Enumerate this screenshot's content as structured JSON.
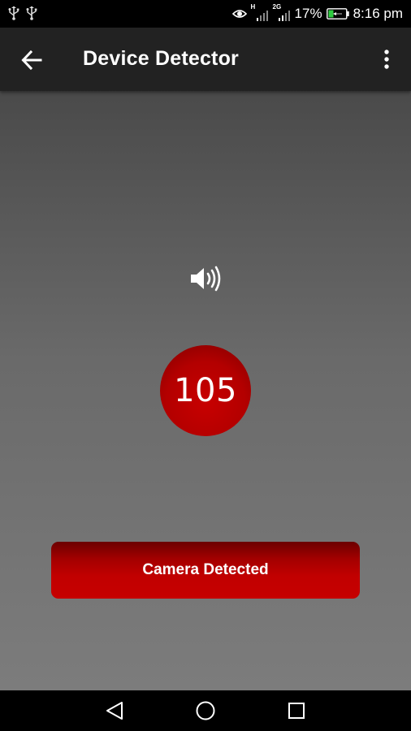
{
  "status_bar": {
    "battery_percent": "17%",
    "time": "8:16 pm",
    "sim1_tag": "H",
    "sim2_tag": "2G",
    "icons": [
      "usb-icon",
      "usb-icon",
      "eye-icon",
      "signal-icon",
      "signal-icon",
      "battery-charging-icon"
    ]
  },
  "app_bar": {
    "title": "Device Detector",
    "back_icon": "arrow-back-icon",
    "menu_icon": "more-vert-icon"
  },
  "main": {
    "sound_icon": "speaker-volume-icon",
    "reading": "105",
    "status_button_label": "Camera Detected"
  },
  "nav_bar": {
    "icons": [
      "nav-back-icon",
      "nav-home-icon",
      "nav-recents-icon"
    ]
  },
  "colors": {
    "app_bar_bg": "#222222",
    "accent_red": "#c00000",
    "content_top": "#4a4a4a",
    "content_bottom": "#7c7c7c"
  }
}
